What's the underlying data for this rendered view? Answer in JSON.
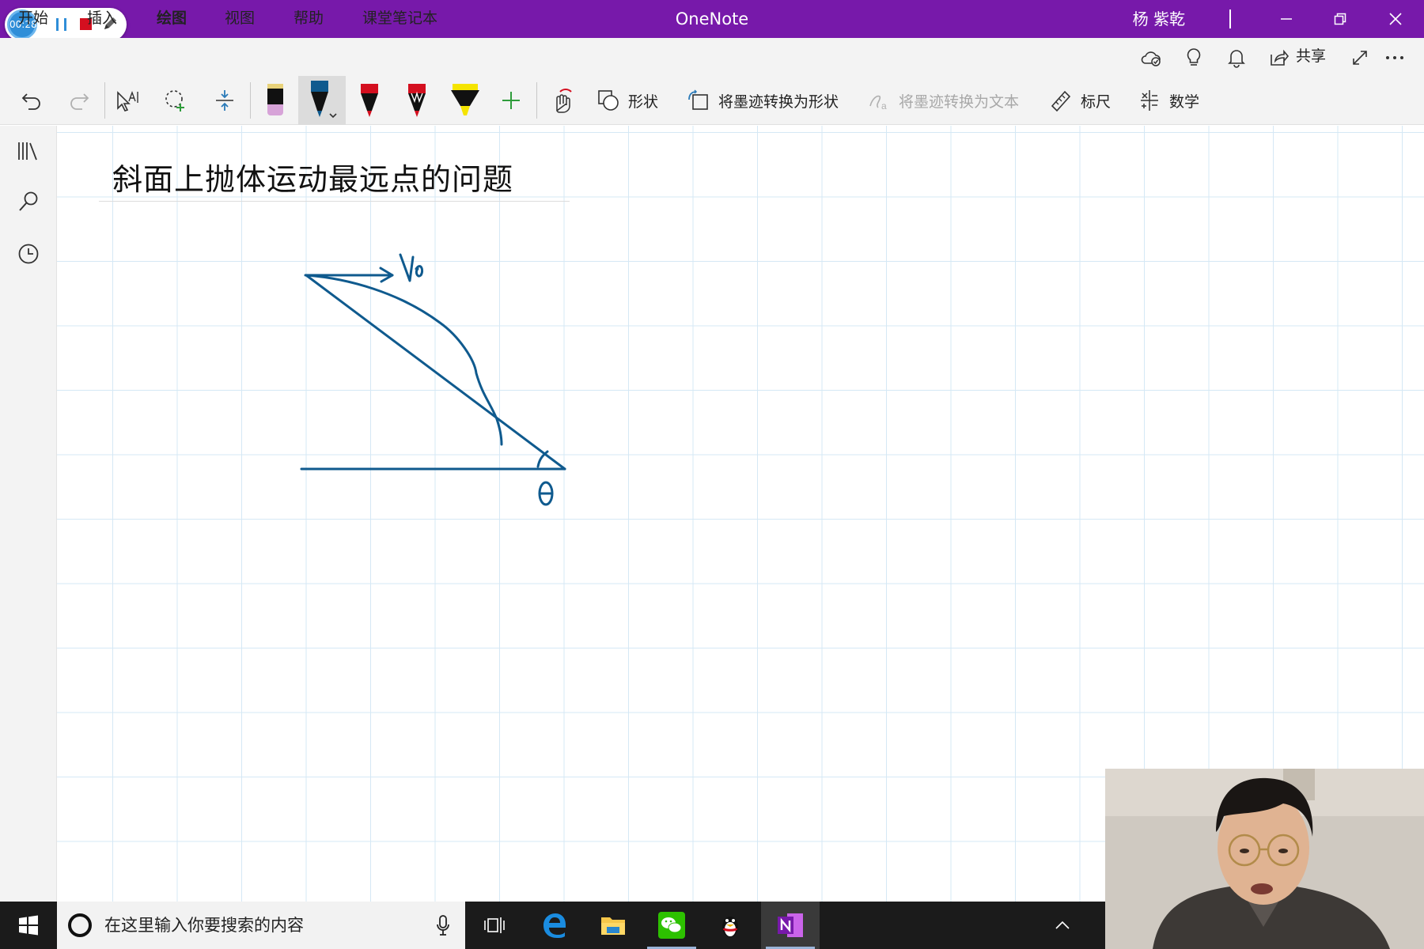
{
  "recorder": {
    "timer": "00:28"
  },
  "titlebar": {
    "app_title": "OneNote",
    "user_name": "杨 紫乾"
  },
  "tabs": [
    "开始",
    "插入",
    "绘图",
    "视图",
    "帮助",
    "课堂笔记本"
  ],
  "active_tab": "绘图",
  "share_label": "共享",
  "toolbar": {
    "shapes_label": "形状",
    "ink_to_shape_label": "将墨迹转换为形状",
    "ink_to_text_label": "将墨迹转换为文本",
    "ruler_label": "标尺",
    "math_label": "数学"
  },
  "page": {
    "title": "斜面上抛体运动最远点的问题"
  },
  "taskbar": {
    "search_placeholder": "在这里输入你要搜索的内容"
  },
  "colors": {
    "accent": "#7719aa",
    "ink": "#0f5a8e"
  }
}
